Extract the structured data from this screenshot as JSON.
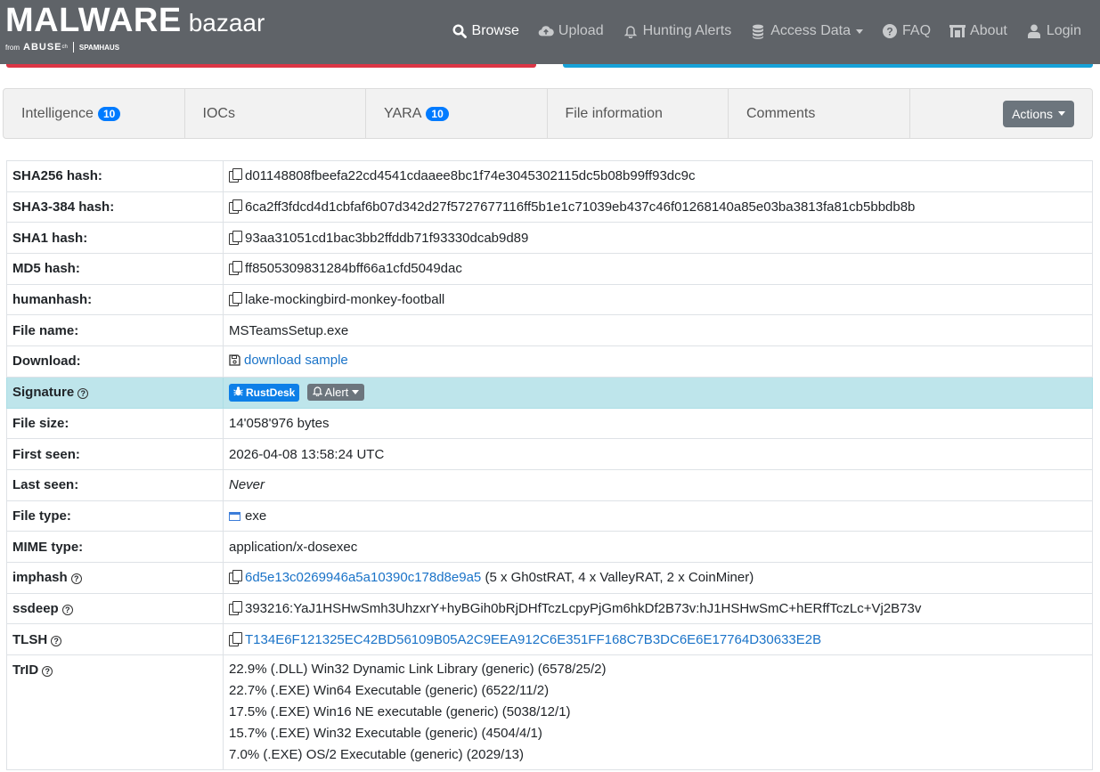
{
  "navbar": {
    "logo_main": "MALWARE",
    "logo_secondary": "bazaar",
    "logo_from": "from",
    "logo_abuse": "ABUSE",
    "logo_abuse_suffix": "ch",
    "logo_spamhaus": "SPAMHAUS",
    "items": [
      {
        "label": "Browse",
        "icon": "search-icon",
        "active": true
      },
      {
        "label": "Upload",
        "icon": "cloud-upload-icon"
      },
      {
        "label": "Hunting Alerts",
        "icon": "bell-icon"
      },
      {
        "label": "Access Data",
        "icon": "database-icon",
        "dropdown": true
      },
      {
        "label": "FAQ",
        "icon": "question-circle-icon"
      },
      {
        "label": "About",
        "icon": "building-icon"
      },
      {
        "label": "Login",
        "icon": "user-icon"
      }
    ]
  },
  "tabs": [
    {
      "label": "Intelligence",
      "badge": "10"
    },
    {
      "label": "IOCs"
    },
    {
      "label": "YARA",
      "badge": "10"
    },
    {
      "label": "File information"
    },
    {
      "label": "Comments"
    }
  ],
  "actions_label": "Actions",
  "colors": {
    "navbar": "#5f6368",
    "strip_left": "#dc3545",
    "strip_right": "#17a2d8",
    "badge": "#007bff",
    "signature_row": "#bee5eb"
  },
  "rows": {
    "sha256": {
      "label": "SHA256 hash:",
      "value": "d01148808fbeefa22cd4541cdaaee8bc1f74e3045302115dc5b08b99ff93dc9c"
    },
    "sha3": {
      "label": "SHA3-384 hash:",
      "value": "6ca2ff3fdcd4d1cbfaf6b07d342d27f5727677116ff5b1e1c71039eb437c46f01268140a85e03ba3813fa81cb5bbdb8b"
    },
    "sha1": {
      "label": "SHA1 hash:",
      "value": "93aa31051cd1bac3bb2ffddb71f93330dcab9d89"
    },
    "md5": {
      "label": "MD5 hash:",
      "value": "ff8505309831284bff66a1cfd5049dac"
    },
    "humanhash": {
      "label": "humanhash:",
      "value": "lake-mockingbird-monkey-football"
    },
    "filename": {
      "label": "File name:",
      "value": "MSTeamsSetup.exe"
    },
    "download": {
      "label": "Download:",
      "link": "download sample"
    },
    "signature": {
      "label": "Signature",
      "tag": "RustDesk",
      "alert": "Alert"
    },
    "filesize": {
      "label": "File size:",
      "value": "14'058'976 bytes"
    },
    "firstseen": {
      "label": "First seen:",
      "value": "2026-04-08 13:58:24 UTC"
    },
    "lastseen": {
      "label": "Last seen:",
      "value": "Never"
    },
    "filetype": {
      "label": "File type:",
      "value": "exe"
    },
    "mime": {
      "label": "MIME type:",
      "value": "application/x-dosexec"
    },
    "imphash": {
      "label": "imphash",
      "link": "6d5e13c0269946a5a10390c178d8e9a5",
      "extra": "(5 x Gh0stRAT, 4 x ValleyRAT, 2 x CoinMiner)"
    },
    "ssdeep": {
      "label": "ssdeep",
      "value": "393216:YaJ1HSHwSmh3UhzxrY+hyBGih0bRjDHfTczLcpyPjGm6hkDf2B73v:hJ1HSHwSmC+hERffTczLc+Vj2B73v"
    },
    "tlsh": {
      "label": "TLSH",
      "link": "T134E6F121325EC42BD56109B05A2C9EEA912C6E351FF168C7B3DC6E6E17764D30633E2B"
    },
    "trid": {
      "label": "TrID",
      "lines": [
        "22.9% (.DLL) Win32 Dynamic Link Library (generic) (6578/25/2)",
        "22.7% (.EXE) Win64 Executable (generic) (6522/11/2)",
        "17.5% (.EXE) Win16 NE executable (generic) (5038/12/1)",
        "15.7% (.EXE) Win32 Executable (generic) (4504/4/1)",
        "7.0% (.EXE) OS/2 Executable (generic) (2029/13)"
      ]
    }
  }
}
